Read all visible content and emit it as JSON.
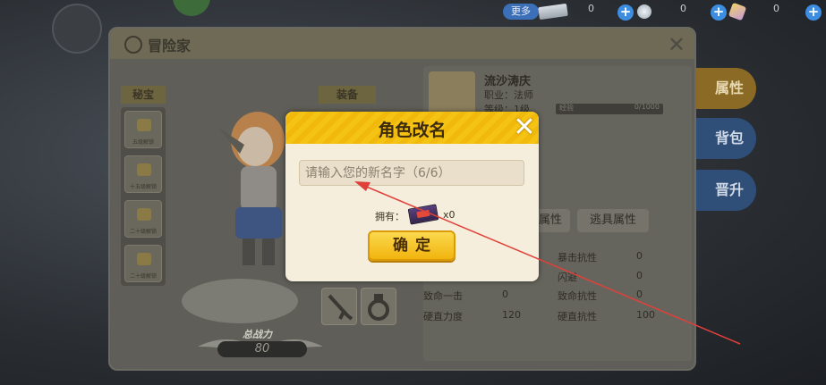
{
  "topbar": {
    "more_label": "更多",
    "resources": [
      {
        "name": "gem",
        "count": "0"
      },
      {
        "name": "silver-coin",
        "count": "0"
      },
      {
        "name": "crystal",
        "count": "0"
      }
    ]
  },
  "side_menu": {
    "attributes_label": "属性",
    "bag_label": "背包",
    "upgrade_label": "晋升"
  },
  "panel": {
    "title": "冒险家",
    "treasure_tag": "秘宝",
    "equipment_tag": "装备",
    "relic_slots": [
      "五级解锁",
      "十五级解锁",
      "二十级解锁",
      "二十级解锁"
    ],
    "power_label": "总战力",
    "power_value": "80"
  },
  "hero": {
    "name": "流沙涛庆",
    "job_label": "职业：",
    "job": "法师",
    "level_label": "等级：",
    "level": "1级",
    "exp_label": "经验",
    "exp_value": "0/1000",
    "tabs": [
      "属性",
      "逃具属性"
    ],
    "stats": [
      {
        "label": "暴击抗性",
        "value": "0"
      },
      {
        "label": "闪避",
        "value": "0"
      },
      {
        "label": "致命一击",
        "value": "0"
      },
      {
        "label": "致命抗性",
        "value": "0"
      },
      {
        "label": "硬直力度",
        "value": "120"
      },
      {
        "label": "硬直抗性",
        "value": "100"
      }
    ]
  },
  "dialog": {
    "title": "角色改名",
    "input_placeholder": "请输入您的新名字（6/6）",
    "own_label": "拥有：",
    "own_count": "x0",
    "confirm_label": "确定"
  },
  "colors": {
    "dialog_header": "#f5c313",
    "dialog_body": "#f6eedc",
    "confirm_button": "#f1b40e",
    "annotation_arrow": "#e0403a"
  }
}
